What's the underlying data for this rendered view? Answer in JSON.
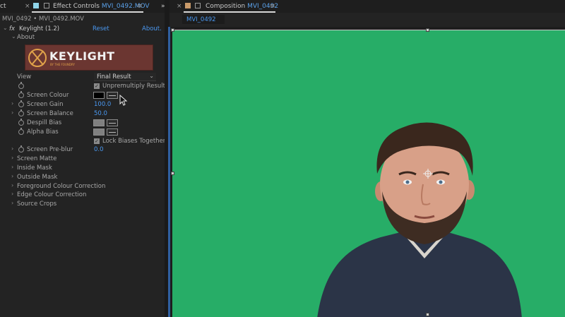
{
  "left_panel": {
    "tabs": [
      {
        "label": "ct"
      },
      {
        "label": "Effect Controls",
        "accent": "MVI_0492.MOV"
      }
    ],
    "breadcrumb": "MVI_0492 • MVI_0492.MOV",
    "effect": {
      "fx_label": "fx",
      "name": "Keylight (1.2)",
      "reset": "Reset",
      "about_link": "About.",
      "about_section": "About",
      "logo_text": "KEYLIGHT",
      "logo_sub": "BY THE FOUNDRY"
    },
    "params": {
      "view_label": "View",
      "view_value": "Final Result",
      "unpremultiply": "Unpremultiply Result",
      "screen_colour": "Screen Colour",
      "screen_gain": "Screen Gain",
      "screen_gain_value": "100.0",
      "screen_balance": "Screen Balance",
      "screen_balance_value": "50.0",
      "despill_bias": "Despill Bias",
      "alpha_bias": "Alpha Bias",
      "lock_biases": "Lock Biases Together",
      "screen_preblur": "Screen Pre-blur",
      "screen_preblur_value": "0.0"
    },
    "groups": [
      "Screen Matte",
      "Inside Mask",
      "Outside Mask",
      "Foreground Colour Correction",
      "Edge Colour Correction",
      "Source Crops"
    ]
  },
  "right_panel": {
    "tab_label": "Composition",
    "tab_accent": "MVI_0492",
    "comp_chip": "MVI_0492"
  },
  "colors": {
    "accent_blue": "#4a98f0",
    "green_screen": "#27ad67",
    "logo_bg": "#6b3631"
  }
}
